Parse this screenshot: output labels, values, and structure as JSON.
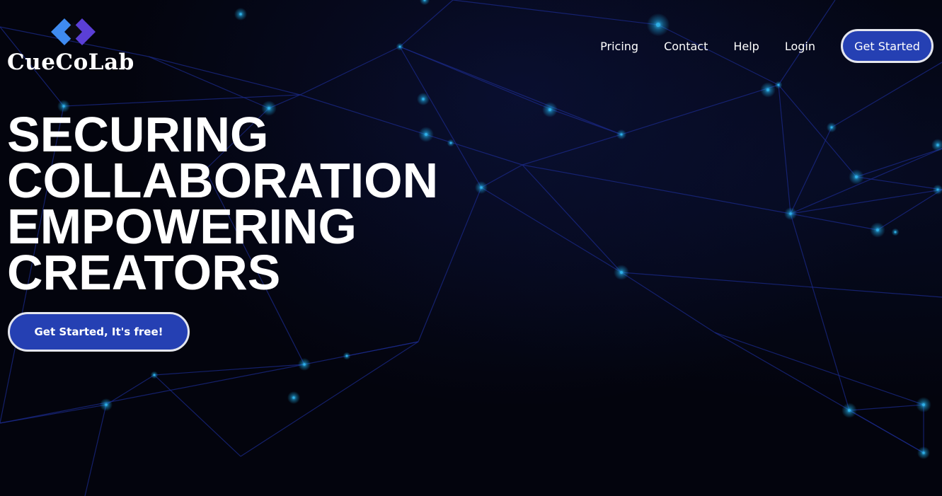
{
  "brand": {
    "name": "CueCoLab",
    "logo_icon": "diamond-logo-icon",
    "colors": {
      "diamond_left": "#3f8bf0",
      "diamond_right": "#5b3fd6",
      "diamond_center": "#0a0a12"
    }
  },
  "nav": {
    "links": [
      {
        "label": "Pricing"
      },
      {
        "label": "Contact"
      },
      {
        "label": "Help"
      },
      {
        "label": "Login"
      }
    ],
    "cta_label": "Get Started"
  },
  "hero": {
    "headline_lines": [
      "SECURING",
      "COLLABORATION",
      "EMPOWERING",
      "CREATORS"
    ],
    "cta_label": "Get Started, It's free!"
  },
  "theme": {
    "background": "#03040d",
    "accent": "#2540b3",
    "button_border": "#e4e6ee",
    "network_line": "#1b2a8a",
    "network_node": "#1e9fd6"
  }
}
